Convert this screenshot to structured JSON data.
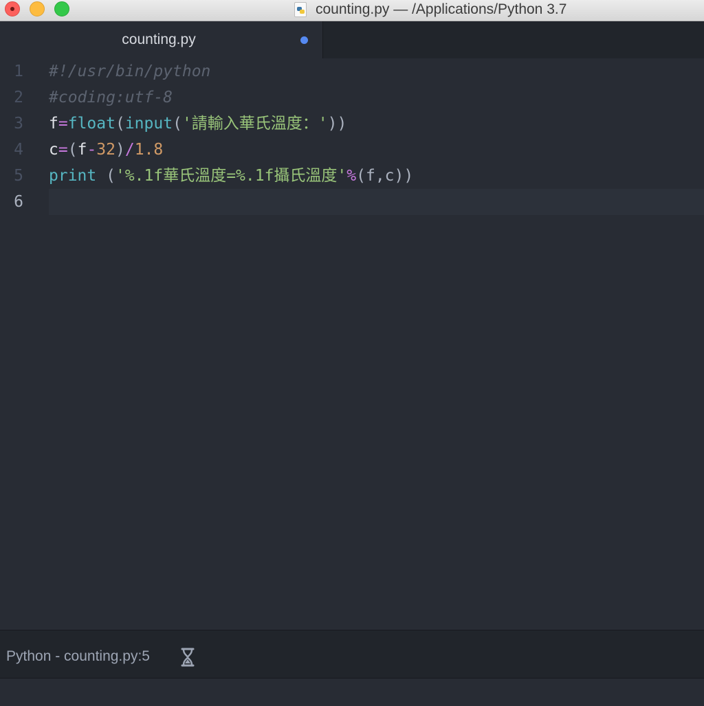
{
  "window": {
    "title": "counting.py — /Applications/Python 3.7",
    "file_icon": "python-file-icon",
    "controls": [
      "close-icon",
      "minimize-icon",
      "maximize-icon"
    ]
  },
  "tabs": [
    {
      "label": "counting.py",
      "modified": true,
      "active": true
    }
  ],
  "editor": {
    "cursor_line": 6,
    "lines": [
      {
        "number": "1",
        "tokens": [
          {
            "t": "#!/usr/bin/python",
            "k": "comment"
          }
        ]
      },
      {
        "number": "2",
        "tokens": [
          {
            "t": "#coding:utf-8",
            "k": "comment"
          }
        ]
      },
      {
        "number": "3",
        "tokens": [
          {
            "t": "f",
            "k": "var"
          },
          {
            "t": "=",
            "k": "op"
          },
          {
            "t": "float",
            "k": "func"
          },
          {
            "t": "(",
            "k": "punc"
          },
          {
            "t": "input",
            "k": "func"
          },
          {
            "t": "(",
            "k": "punc"
          },
          {
            "t": "'請輸入華氏溫度：'",
            "k": "str"
          },
          {
            "t": "))",
            "k": "punc"
          }
        ]
      },
      {
        "number": "4",
        "tokens": [
          {
            "t": "c",
            "k": "var"
          },
          {
            "t": "=",
            "k": "op"
          },
          {
            "t": "(",
            "k": "punc"
          },
          {
            "t": "f",
            "k": "var"
          },
          {
            "t": "-",
            "k": "op"
          },
          {
            "t": "32",
            "k": "num"
          },
          {
            "t": ")",
            "k": "punc"
          },
          {
            "t": "/",
            "k": "op"
          },
          {
            "t": "1.8",
            "k": "num"
          }
        ]
      },
      {
        "number": "5",
        "tokens": [
          {
            "t": "print",
            "k": "func"
          },
          {
            "t": " (",
            "k": "punc"
          },
          {
            "t": "'%.1f華氏溫度=%.1f攝氏溫度'",
            "k": "str"
          },
          {
            "t": "%",
            "k": "op"
          },
          {
            "t": "(f,c))",
            "k": "punc"
          }
        ]
      },
      {
        "number": "6",
        "tokens": []
      }
    ]
  },
  "statusbar": {
    "grammar_and_file": "Python - counting.py:5",
    "busy_icon": "hourglass-icon"
  },
  "colors": {
    "editor_bg": "#282c34",
    "comment": "#5c6370",
    "keyword_op": "#c678dd",
    "function": "#56b6c2",
    "string": "#98c379",
    "number": "#d19a66",
    "modified_dot": "#568af2"
  }
}
